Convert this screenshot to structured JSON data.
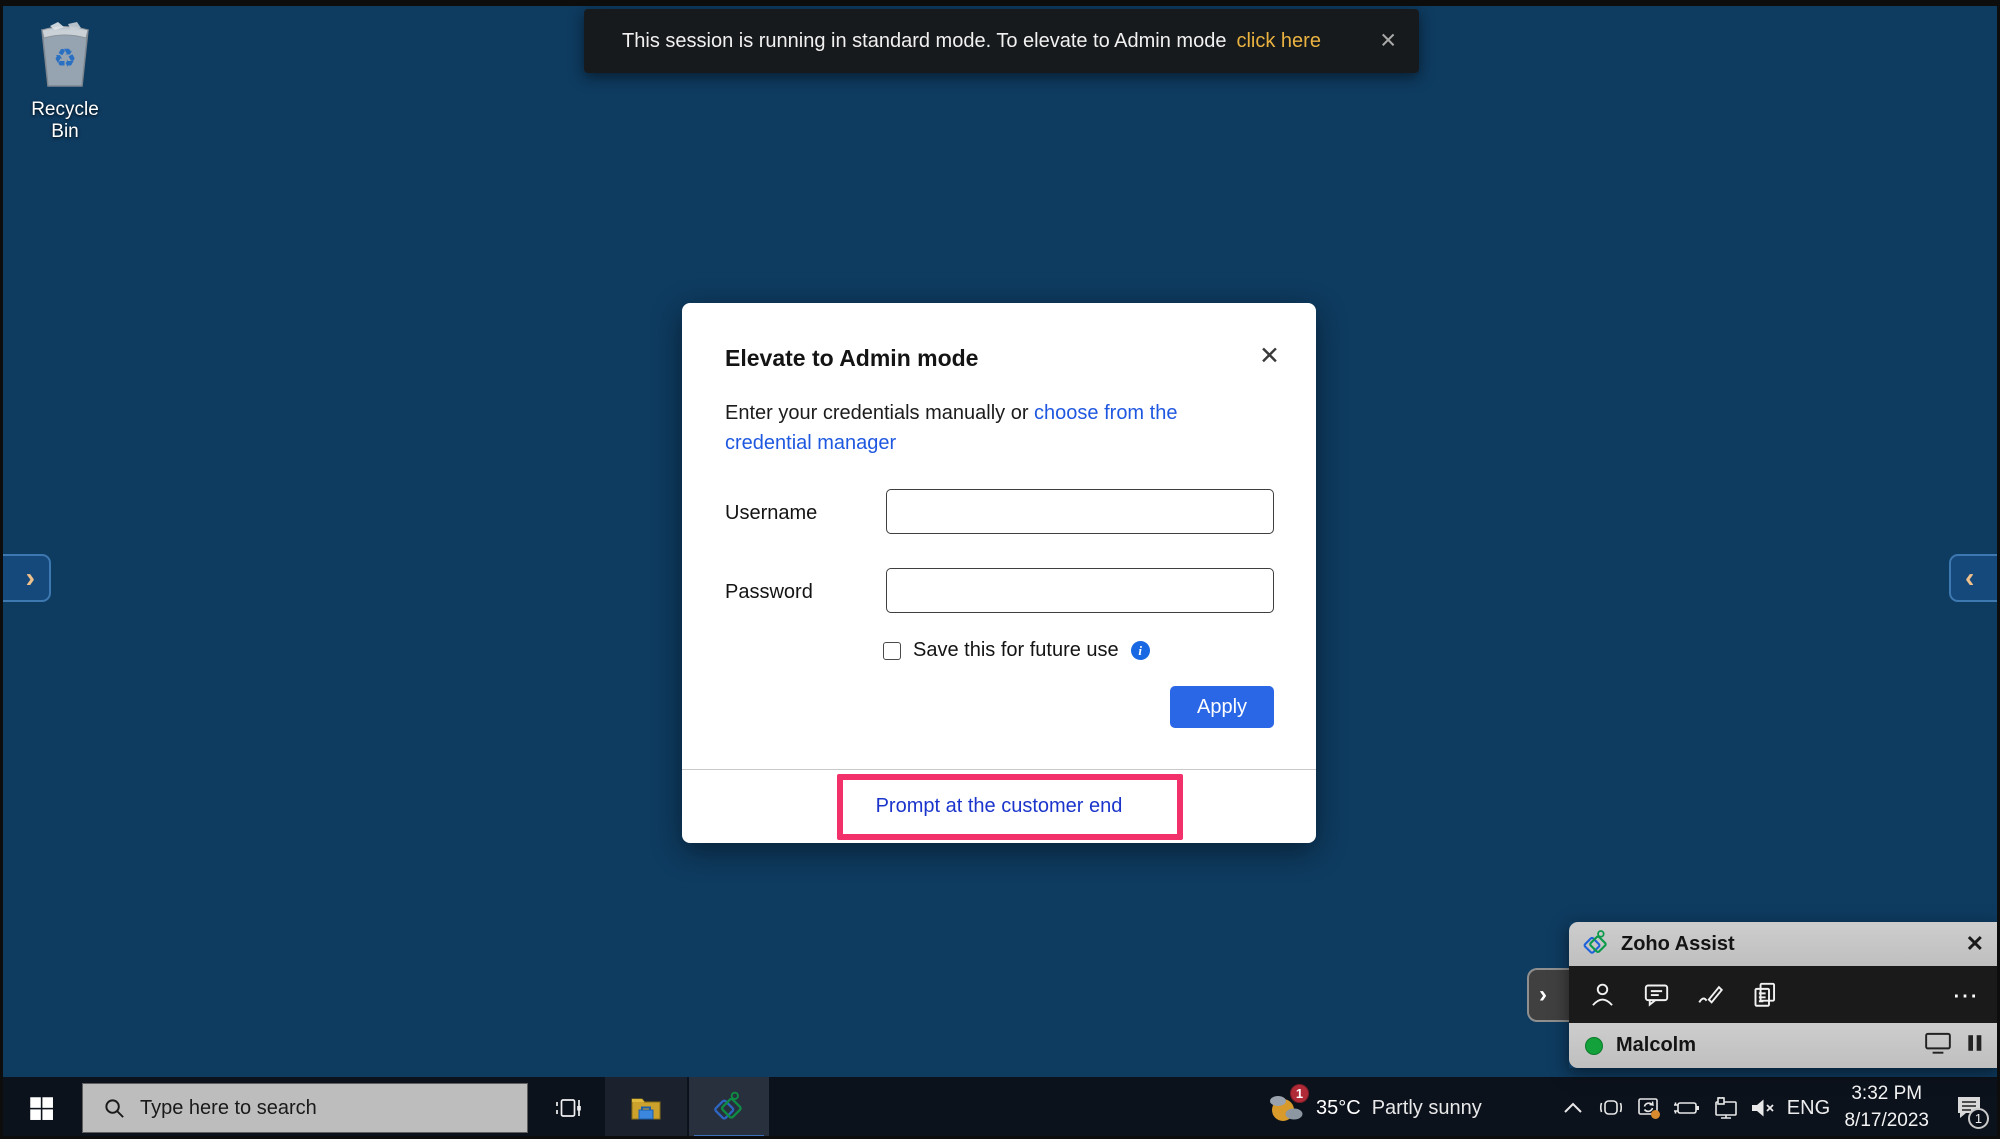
{
  "banner": {
    "message": "This session is running in standard mode. To elevate to Admin mode",
    "link_label": "click here",
    "close_glyph": "✕"
  },
  "desktop": {
    "recycle_bin_label": "Recycle Bin",
    "left_edge_chevron": "›",
    "right_edge_chevron": "‹"
  },
  "dialog": {
    "title": "Elevate to Admin mode",
    "close_glyph": "✕",
    "intro_text": "Enter your credentials manually or",
    "intro_link_line1": "choose from the",
    "intro_link_line2": "credential manager",
    "username_label": "Username",
    "username_value": "",
    "password_label": "Password",
    "password_value": "",
    "save_checkbox_label": "Save this for future use",
    "info_glyph": "i",
    "apply_label": "Apply",
    "footer_link": "Prompt at the customer end"
  },
  "zoho_widget": {
    "title": "Zoho Assist",
    "close_glyph": "✕",
    "more_glyph": "⋯",
    "collapse_chevron": "›",
    "participant_name": "Malcolm"
  },
  "taskbar": {
    "search_placeholder": "Type here to search",
    "weather_temperature": "35°C",
    "weather_condition": "Partly sunny",
    "weather_badge": "1",
    "language": "ENG",
    "time": "3:32 PM",
    "date": "8/17/2023",
    "action_center_badge": "1"
  },
  "colors": {
    "desktop_bg": "#0e3b60",
    "taskbar_bg": "#0c121c",
    "accent_blue": "#2a67e6",
    "link_blue": "#1f58e0",
    "footer_link_blue": "#1b35cc",
    "highlight_red": "#f2316b",
    "banner_link_gold": "#e9b240",
    "zoho_green": "#0a9a4a",
    "zoho_blue": "#1f62d9",
    "status_green": "#12a13a"
  }
}
